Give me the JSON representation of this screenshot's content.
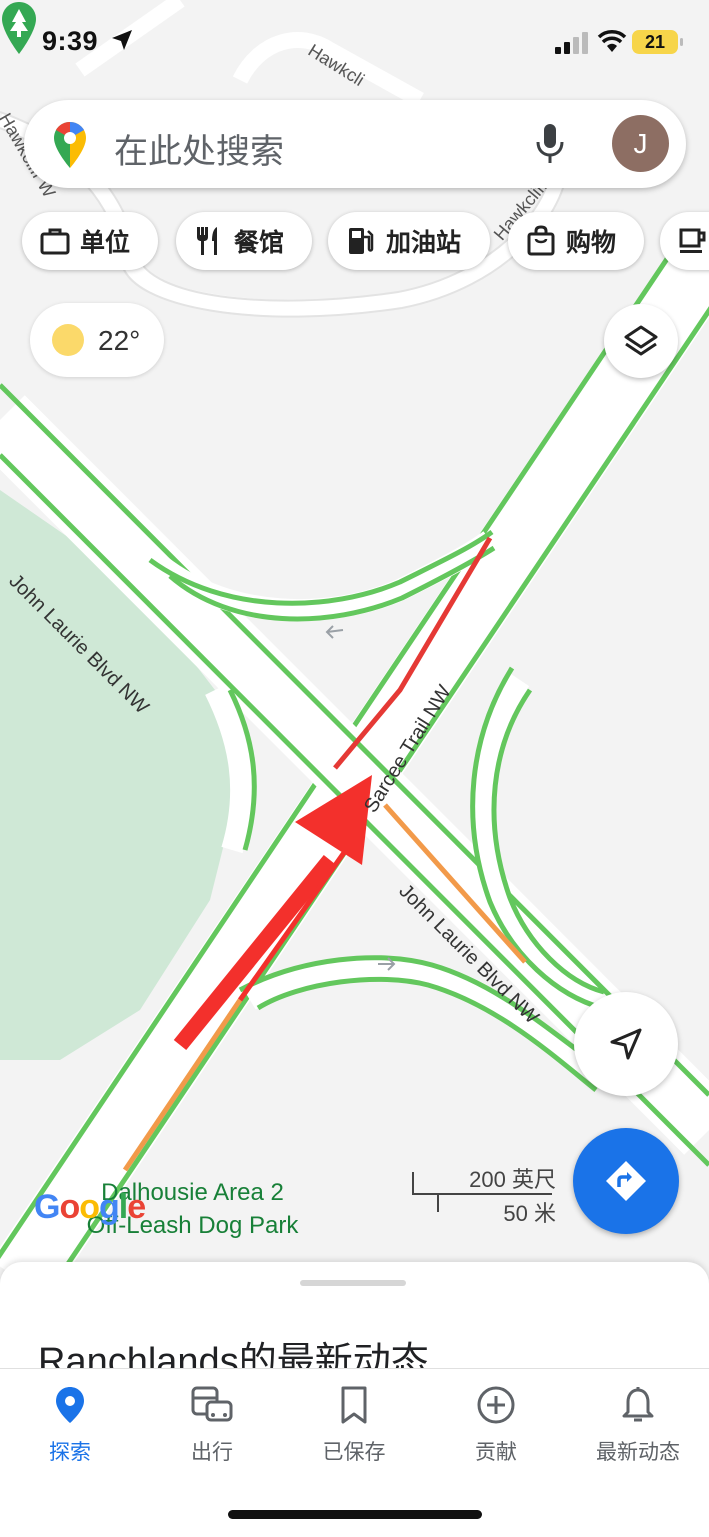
{
  "status_bar": {
    "time": "9:39",
    "battery": "21"
  },
  "search": {
    "placeholder": "在此处搜索",
    "avatar_initial": "J"
  },
  "chips": [
    {
      "label": "单位",
      "icon": "briefcase-icon"
    },
    {
      "label": "餐馆",
      "icon": "restaurant-icon"
    },
    {
      "label": "加油站",
      "icon": "gas-station-icon"
    },
    {
      "label": "购物",
      "icon": "shopping-bag-icon"
    },
    {
      "label": "",
      "icon": "coffee-icon"
    }
  ],
  "weather": {
    "temperature": "22°"
  },
  "map": {
    "streets": [
      "Hawkcli",
      "Hawkcliff",
      "Hawkcliff W",
      "John Laurie Blvd NW",
      "Sarcee Trail NW",
      "John Laurie Blvd NW"
    ],
    "poi": {
      "name_line1": "Dalhousie Area 2",
      "name_line2": "Off-Leash Dog Park"
    },
    "scale": {
      "feet": "200 英尺",
      "meters": "50 米"
    },
    "logo": "Google",
    "traffic_colors": {
      "free": "#63c75d",
      "slow": "#f29a4a",
      "heavy": "#e53935"
    }
  },
  "sheet": {
    "title": "Ranchlands的最新动态"
  },
  "bottom_nav": [
    {
      "label": "探索",
      "icon": "explore-pin-icon",
      "active": true
    },
    {
      "label": "出行",
      "icon": "commute-icon",
      "active": false
    },
    {
      "label": "已保存",
      "icon": "bookmark-icon",
      "active": false
    },
    {
      "label": "贡献",
      "icon": "add-circle-icon",
      "active": false
    },
    {
      "label": "最新动态",
      "icon": "bell-icon",
      "active": false
    }
  ]
}
